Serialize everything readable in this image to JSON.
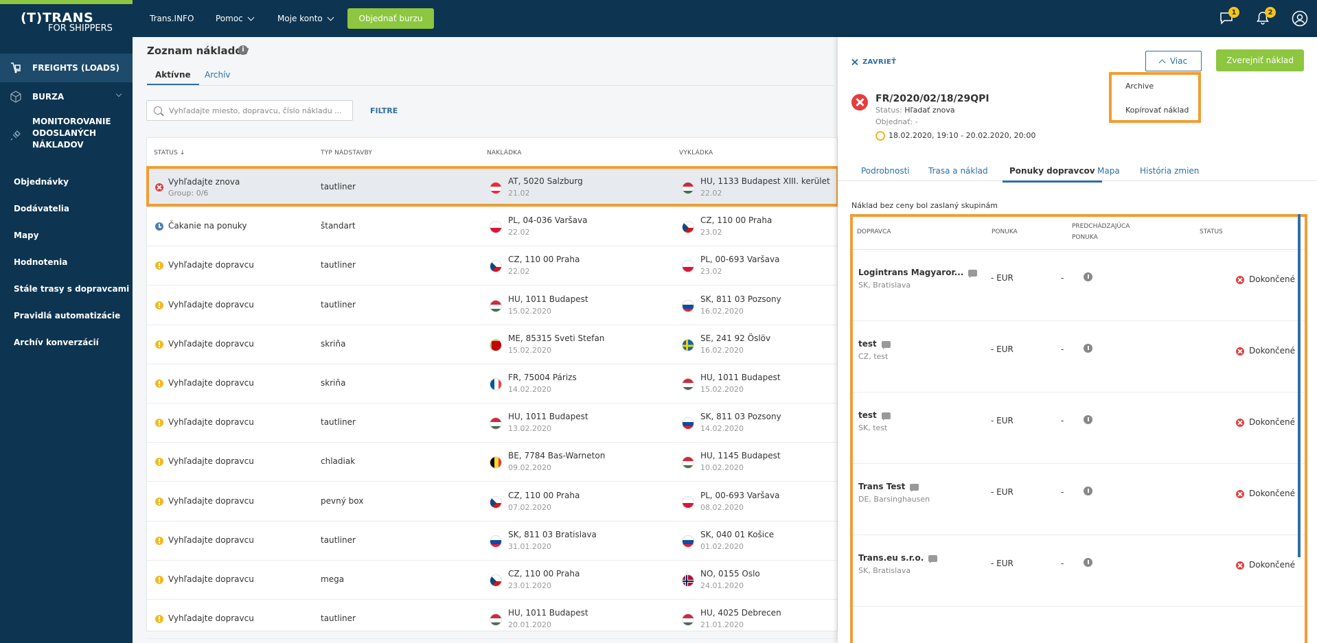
{
  "app": {
    "logo_line1": "(T)TRANS",
    "logo_line2": "FOR SHIPPERS"
  },
  "topnav": {
    "transinfo": "Trans.INFO",
    "pomoc": "Pomoc",
    "moje_konto": "Moje konto",
    "order_button": "Objednať burzu",
    "messages_badge": "1",
    "notifications_badge": "2"
  },
  "sidebar": {
    "main": [
      {
        "label": "FREIGHTS (LOADS)"
      },
      {
        "label": "BURZA"
      },
      {
        "label": "MONITOROVANIE ODOSLANÝCH NÁKLADOV"
      }
    ],
    "sub": [
      {
        "label": "Objednávky"
      },
      {
        "label": "Dodávatelia"
      },
      {
        "label": "Mapy"
      },
      {
        "label": "Hodnotenia"
      },
      {
        "label": "Stále trasy s dopravcami"
      },
      {
        "label": "Pravidlá automatizácie"
      },
      {
        "label": "Archív konverzácií"
      }
    ]
  },
  "list": {
    "title": "Zoznam nákladov",
    "info_glyph": "i",
    "tabs": [
      "Aktívne",
      "Archív"
    ],
    "search_placeholder": "Vyhľadajte miesto, dopravcu, číslo nákladu ...",
    "filter_label": "FILTRE",
    "columns": [
      "STATUS ↓",
      "TYP NÁDSTAVBY",
      "NAKLÁDKA",
      "VYKLÁDKA"
    ],
    "rows": [
      {
        "status": "Vyhľadajte znova",
        "sub": "Group: 0/6",
        "icon": "red",
        "typ": "tautliner",
        "from_flag": "AT",
        "from": "AT, 5020 Salzburg",
        "from_date": "21.02",
        "to_flag": "HU",
        "to": "HU, 1133 Budapest XIII. kerület",
        "to_date": "22.02"
      },
      {
        "status": "Čakanie na ponuky",
        "sub": "",
        "icon": "blue",
        "typ": "štandart",
        "from_flag": "PL",
        "from": "PL, 04-036 Varšava",
        "from_date": "22.02",
        "to_flag": "CZ",
        "to": "CZ, 110 00 Praha",
        "to_date": "23.02"
      },
      {
        "status": "Vyhľadajte dopravcu",
        "sub": "",
        "icon": "yellow",
        "typ": "tautliner",
        "from_flag": "CZ",
        "from": "CZ, 110 00 Praha",
        "from_date": "22.02",
        "to_flag": "PL",
        "to": "PL, 00-693 Varšava",
        "to_date": "23.02"
      },
      {
        "status": "Vyhľadajte dopravcu",
        "sub": "",
        "icon": "yellow",
        "typ": "tautliner",
        "from_flag": "HU",
        "from": "HU, 1011 Budapest",
        "from_date": "15.02.2020",
        "to_flag": "SK",
        "to": "SK, 811 03 Pozsony",
        "to_date": "16.02.2020"
      },
      {
        "status": "Vyhľadajte dopravcu",
        "sub": "",
        "icon": "yellow",
        "typ": "skriňa",
        "from_flag": "ME",
        "from": "ME, 85315 Sveti Stefan",
        "from_date": "15.02.2020",
        "to_flag": "SE",
        "to": "SE, 241 92 Öslöv",
        "to_date": "16.02.2020"
      },
      {
        "status": "Vyhľadajte dopravcu",
        "sub": "",
        "icon": "yellow",
        "typ": "skriňa",
        "from_flag": "FR",
        "from": "FR, 75004 Párizs",
        "from_date": "14.02.2020",
        "to_flag": "HU",
        "to": "HU, 1011 Budapest",
        "to_date": "15.02.2020"
      },
      {
        "status": "Vyhľadajte dopravcu",
        "sub": "",
        "icon": "yellow",
        "typ": "tautliner",
        "from_flag": "HU",
        "from": "HU, 1011 Budapest",
        "from_date": "13.02.2020",
        "to_flag": "SK",
        "to": "SK, 811 03 Pozsony",
        "to_date": "14.02.2020"
      },
      {
        "status": "Vyhľadajte dopravcu",
        "sub": "",
        "icon": "yellow",
        "typ": "chladiak",
        "from_flag": "BE",
        "from": "BE, 7784 Bas-Warneton",
        "from_date": "09.02.2020",
        "to_flag": "HU",
        "to": "HU, 1145 Budapest",
        "to_date": "10.02.2020"
      },
      {
        "status": "Vyhľadajte dopravcu",
        "sub": "",
        "icon": "yellow",
        "typ": "pevný box",
        "from_flag": "CZ",
        "from": "CZ, 110 00 Praha",
        "from_date": "07.02.2020",
        "to_flag": "PL",
        "to": "PL, 00-693 Varšava",
        "to_date": "08.02.2020"
      },
      {
        "status": "Vyhľadajte dopravcu",
        "sub": "",
        "icon": "yellow",
        "typ": "tautliner",
        "from_flag": "SK",
        "from": "SK, 811 03 Bratislava",
        "from_date": "31.01.2020",
        "to_flag": "SK",
        "to": "SK, 040 01 Košice",
        "to_date": "01.02.2020"
      },
      {
        "status": "Vyhľadajte dopravcu",
        "sub": "",
        "icon": "yellow",
        "typ": "mega",
        "from_flag": "CZ",
        "from": "CZ, 110 00 Praha",
        "from_date": "23.01.2020",
        "to_flag": "NO",
        "to": "NO, 0155 Oslo",
        "to_date": "24.01.2020"
      },
      {
        "status": "Vyhľadajte dopravcu",
        "sub": "",
        "icon": "yellow",
        "typ": "tautliner",
        "from_flag": "HU",
        "from": "HU, 1011 Budapest",
        "from_date": "20.01.2020",
        "to_flag": "HU",
        "to": "HU, 4025 Debrecen",
        "to_date": "21.01.2020"
      }
    ]
  },
  "detail": {
    "close_label": "ZAVRIEŤ",
    "more_label": "Viac",
    "publish_label": "Zverejniť náklad",
    "dropdown": [
      "Archive",
      "Kopírovať náklad"
    ],
    "freight_id": "FR/2020/02/18/29QPI",
    "status_label": "Status:",
    "status_value": "Hľadať znova",
    "ordered": "Objednať: -",
    "time_range": "18.02.2020, 19:10 - 20.02.2020, 20:00",
    "tabs": [
      "Podrobnosti",
      "Trasa a náklad",
      "Ponuky dopravcov",
      "Mapa",
      "História zmien"
    ],
    "note": "Náklad bez ceny bol zaslaný skupinám",
    "columns": {
      "carrier": "DOPRAVCA",
      "offer": "PONUKA",
      "prev_line1": "PREDCHÁDZAJÚCA",
      "prev_line2": "PONUKA",
      "status": "STATUS"
    },
    "offers": [
      {
        "name": "Logintrans Magyaror...",
        "location": "SK, Bratislava",
        "offer": "-  EUR",
        "prev": "-",
        "status": "Dokončené"
      },
      {
        "name": "test",
        "location": "CZ, test",
        "offer": "-  EUR",
        "prev": "-",
        "status": "Dokončené"
      },
      {
        "name": "test",
        "location": "SK, test",
        "offer": "-  EUR",
        "prev": "-",
        "status": "Dokončené"
      },
      {
        "name": "Trans Test",
        "location": "DE, Barsinghausen",
        "offer": "-  EUR",
        "prev": "-",
        "status": "Dokončené"
      },
      {
        "name": "Trans.eu s.r.o.",
        "location": "SK, Bratislava",
        "offer": "-  EUR",
        "prev": "-",
        "status": "Dokončené"
      }
    ]
  },
  "colors": {
    "navy": "#0d3450",
    "accent_green": "#8dc63f",
    "link_blue": "#2c6fa8",
    "highlight_orange": "#f39c32",
    "error_red": "#e63c3c",
    "warn_yellow": "#f2b91f"
  }
}
